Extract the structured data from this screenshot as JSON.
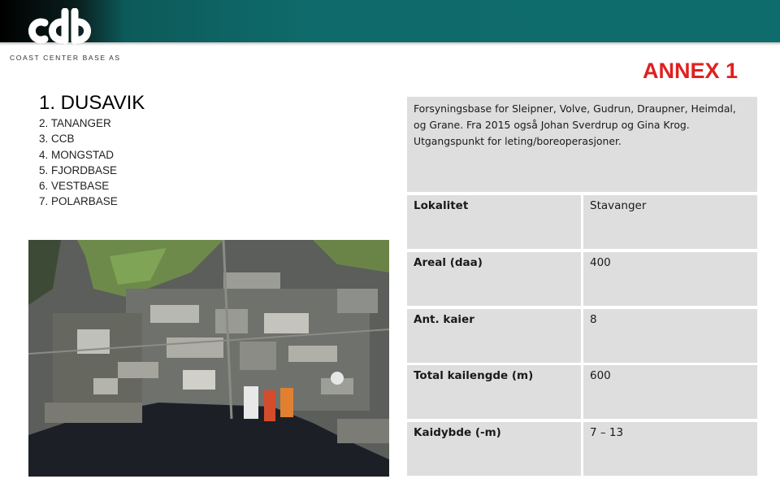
{
  "brand": {
    "company_name": "COAST CENTER BASE AS",
    "logo_text": "ccb"
  },
  "annex": "ANNEX 1",
  "bases": [
    "1. DUSAVIK",
    "2. TANANGER",
    "3. CCB",
    "4. MONGSTAD",
    "5. FJORDBASE",
    "6. VESTBASE",
    "7. POLARBASE"
  ],
  "description": "Forsyningsbase for Sleipner, Volve, Gudrun, Draupner, Heimdal, og Grane. Fra 2015 også Johan Sverdrup og Gina Krog. Utgangspunkt for leting/boreoperasjoner.",
  "table": [
    {
      "label": "Lokalitet",
      "value": "Stavanger"
    },
    {
      "label": "Areal (daa)",
      "value": "400"
    },
    {
      "label": "Ant. kaier",
      "value": "8"
    },
    {
      "label": "Total kailengde (m)",
      "value": "600"
    },
    {
      "label": "Kaidybde (-m)",
      "value": "7 – 13"
    }
  ],
  "colors": {
    "header": "#0f6c6c",
    "annex": "#e02020",
    "cell_bg": "#dedede"
  }
}
